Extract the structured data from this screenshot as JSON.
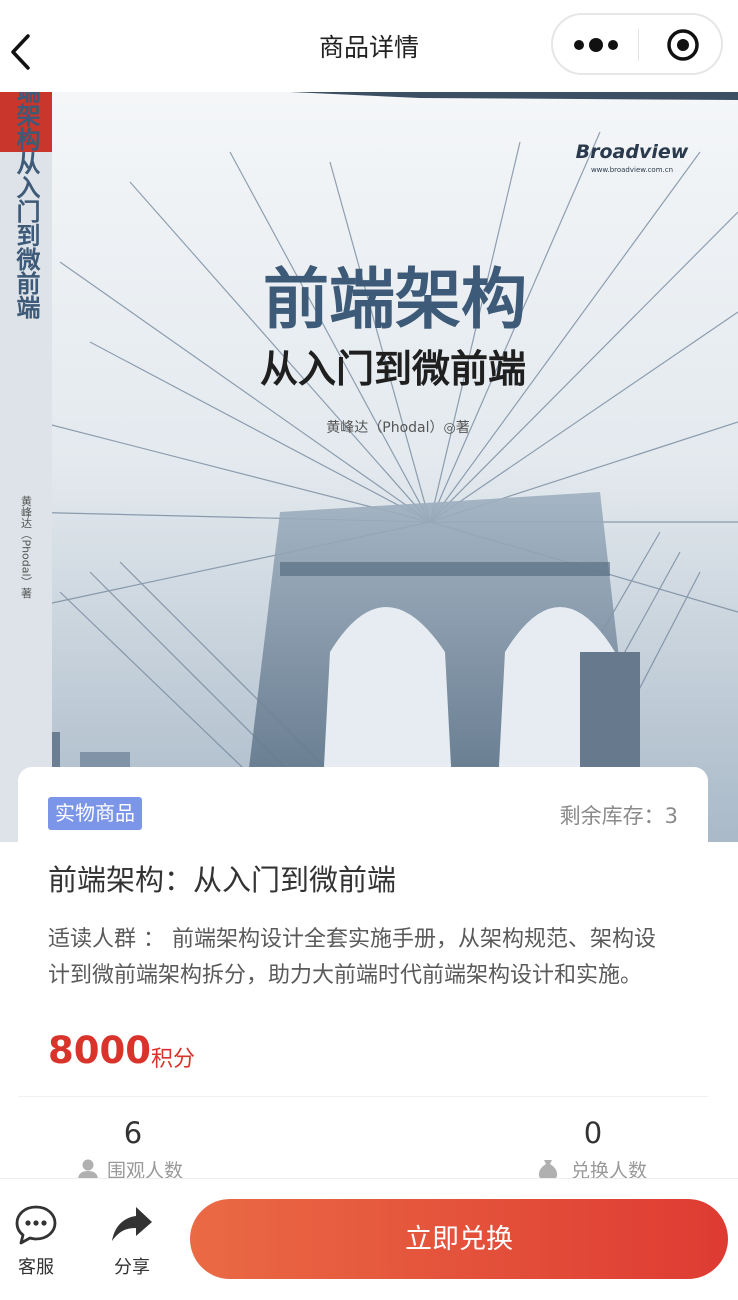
{
  "header": {
    "title": "商品详情",
    "icons": {
      "back": "chevron-left-icon",
      "more": "more-dots-icon",
      "close": "target-circle-icon"
    }
  },
  "cover": {
    "publisher": "Broadview",
    "publisher_site": "www.broadview.com.cn",
    "title": "前端架构",
    "subtitle": "从入门到微前端",
    "author_line": "黄峰达（Phodal）◎著",
    "spine_title": "前端架构从入门到微前端",
    "spine_author": "黄峰达（Phodal）著"
  },
  "product": {
    "tag": "实物商品",
    "stock_label": "剩余库存：",
    "stock_value": "3",
    "title": "前端架构：从入门到微前端",
    "description": "适读人群 ： 前端架构设计全套实施手册，从架构规范、架构设计到微前端架构拆分，助力大前端时代前端架构设计和实施。"
  },
  "price": {
    "value": "8000",
    "unit": "积分"
  },
  "stats": {
    "views": {
      "value": "6",
      "label": "围观人数",
      "icon": "user-icon"
    },
    "redemptions": {
      "value": "0",
      "label": "兑换人数",
      "icon": "money-bag-icon"
    }
  },
  "bottom_bar": {
    "service_label": "客服",
    "share_label": "分享",
    "redeem_label": "立即兑换"
  },
  "colors": {
    "accent": "#d9342b",
    "tag": "#7b95e8",
    "button_start": "#ea6a44",
    "button_end": "#de3b32"
  }
}
